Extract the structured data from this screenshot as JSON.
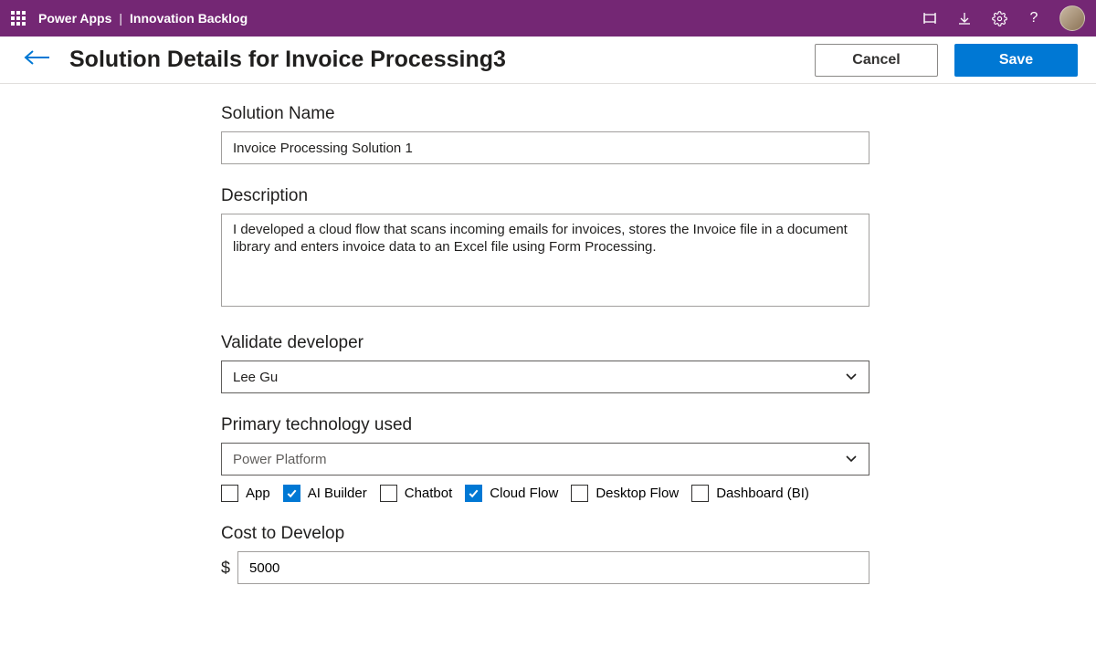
{
  "topbar": {
    "product": "Power Apps",
    "appName": "Innovation Backlog"
  },
  "commandbar": {
    "title": "Solution Details for Invoice Processing3",
    "cancel": "Cancel",
    "save": "Save"
  },
  "form": {
    "solutionName": {
      "label": "Solution Name",
      "value": "Invoice Processing Solution 1"
    },
    "description": {
      "label": "Description",
      "value": "I developed a cloud flow that scans incoming emails for invoices, stores the Invoice file in a document library and enters invoice data to an Excel file using Form Processing."
    },
    "validateDeveloper": {
      "label": "Validate developer",
      "value": "Lee Gu"
    },
    "primaryTech": {
      "label": "Primary technology used",
      "value": "Power Platform",
      "options": [
        {
          "label": "App",
          "checked": false
        },
        {
          "label": "AI Builder",
          "checked": true
        },
        {
          "label": "Chatbot",
          "checked": false
        },
        {
          "label": "Cloud Flow",
          "checked": true
        },
        {
          "label": "Desktop Flow",
          "checked": false
        },
        {
          "label": "Dashboard (BI)",
          "checked": false
        }
      ]
    },
    "cost": {
      "label": "Cost to Develop",
      "currency": "$",
      "value": "5000"
    }
  }
}
